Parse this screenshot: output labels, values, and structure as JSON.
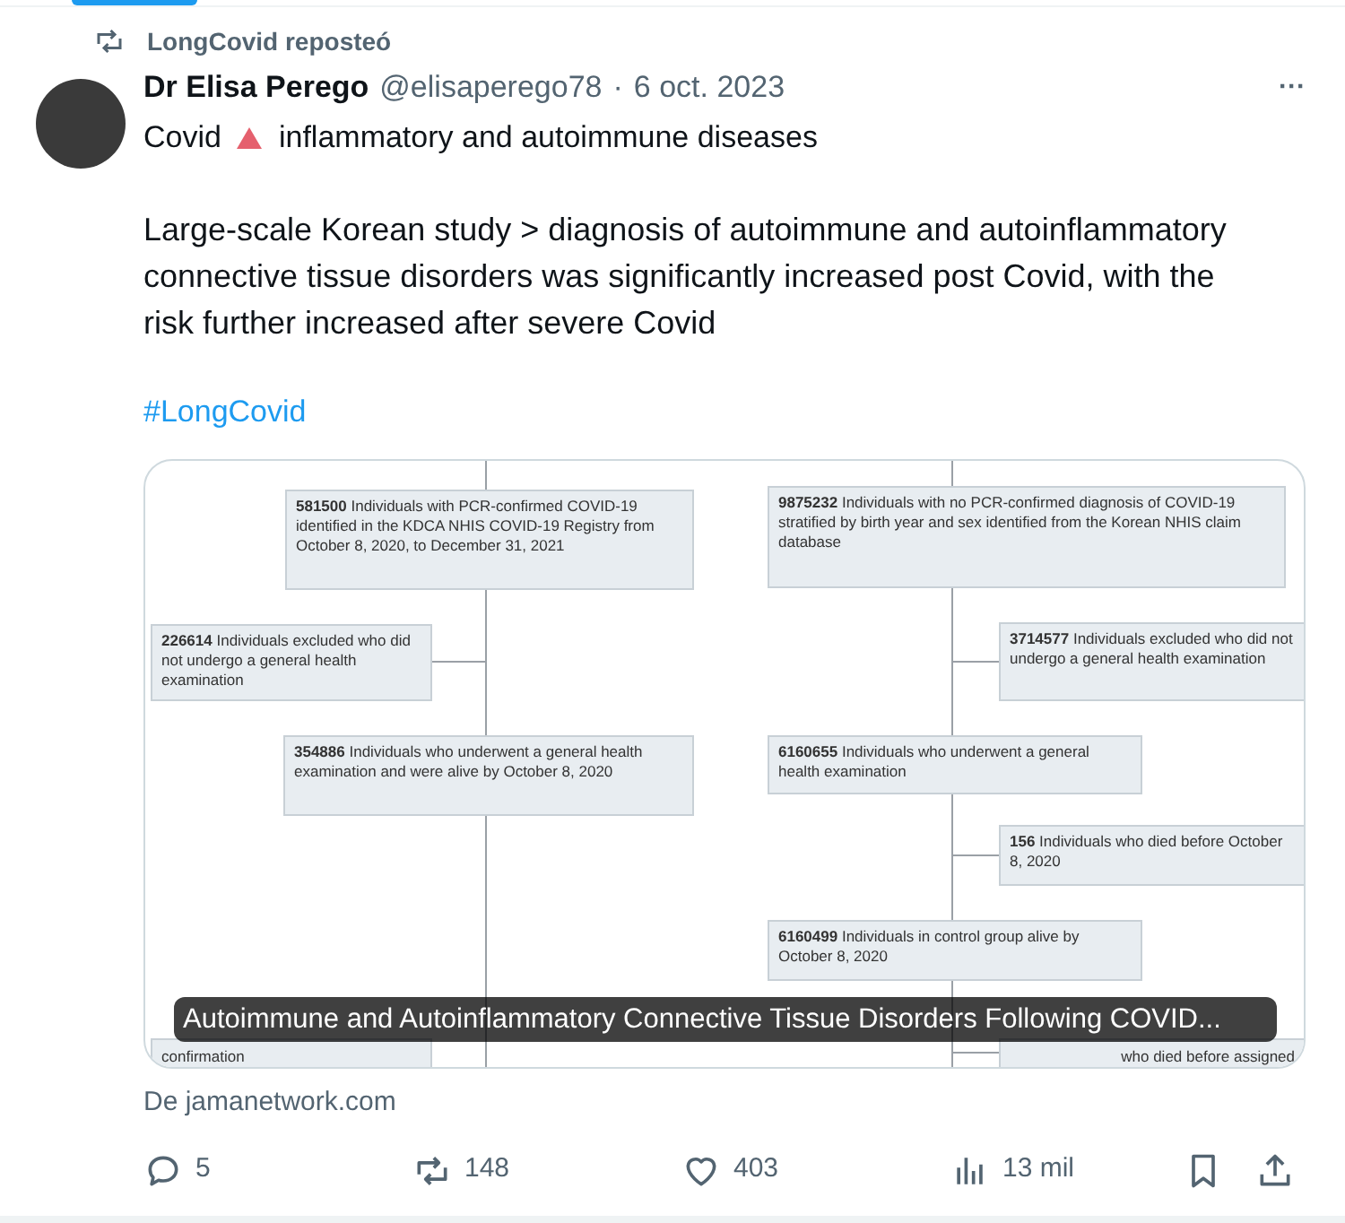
{
  "repost": {
    "label": "LongCovid reposteó"
  },
  "tweet": {
    "author": "Dr Elisa Perego",
    "handle": "@elisaperego78",
    "separator": "·",
    "date": "6 oct. 2023",
    "more": "···",
    "first_line": [
      "Covid",
      "inflammatory and autoimmune diseases"
    ],
    "body": "Large-scale Korean study > diagnosis of autoimmune and autoinflammatory connective tissue disorders was significantly increased post Covid, with the risk further increased after severe Covid",
    "hashtag": "#LongCovid"
  },
  "card": {
    "caption": "Autoimmune and Autoinflammatory Connective Tissue Disorders Following COVID...",
    "boxes": [
      {
        "text": "**581500** Individuals with PCR-confirmed COVID-19 identified in the KDCA NHIS COVID-19 Registry from October 8, 2020, to December 31, 2021"
      },
      {
        "text": "**226614** Individuals excluded who did not undergo a general health examination"
      },
      {
        "text": "**354886** Individuals who underwent a general health examination and were alive by October 8, 2020"
      },
      {
        "text": "**9875232** Individuals with no PCR-confirmed diagnosis of COVID-19 stratified by birth year and sex identified from the Korean NHIS claim database"
      },
      {
        "text": "**3714577** Individuals excluded who did not undergo a general health examination"
      },
      {
        "text": "**6160655** Individuals who underwent a general health examination"
      },
      {
        "text": "**156** Individuals who died before October 8, 2020"
      },
      {
        "text": "**6160499** Individuals in control group alive by October 8, 2020"
      },
      {
        "text": "confirmation"
      },
      {
        "text": "who died before assigned"
      }
    ]
  },
  "source": "De jamanetwork.com",
  "actions": [
    {
      "kind": "reply",
      "count": "5"
    },
    {
      "kind": "repost",
      "count": "148"
    },
    {
      "kind": "like",
      "count": "403"
    },
    {
      "kind": "views",
      "count": "13 mil"
    },
    {
      "kind": "bookmark"
    },
    {
      "kind": "share"
    }
  ]
}
